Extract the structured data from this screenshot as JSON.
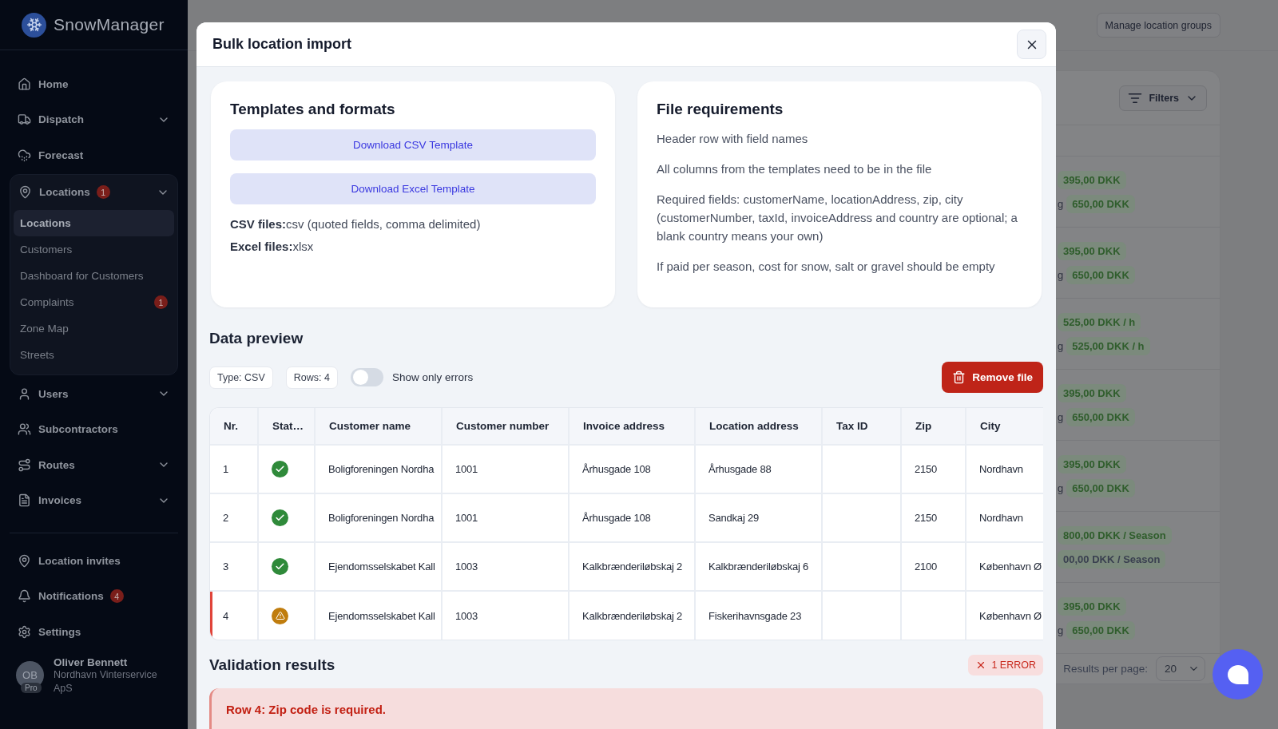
{
  "sidebar": {
    "logo": "SnowManager",
    "nav": [
      {
        "label": "Home"
      },
      {
        "label": "Dispatch",
        "expandable": true
      },
      {
        "label": "Forecast"
      },
      {
        "label": "Locations",
        "badge": "1",
        "expandable": true,
        "children": [
          {
            "label": "Locations",
            "selected": true
          },
          {
            "label": "Customers",
            "selected": false
          },
          {
            "label": "Dashboard for Customers",
            "selected": false
          },
          {
            "label": "Complaints",
            "selected": false,
            "badge": "1"
          },
          {
            "label": "Zone Map",
            "selected": false
          },
          {
            "label": "Streets",
            "selected": false
          }
        ]
      },
      {
        "label": "Users",
        "expandable": true
      },
      {
        "label": "Subcontractors"
      },
      {
        "label": "Routes",
        "expandable": true
      },
      {
        "label": "Invoices",
        "expandable": true
      }
    ],
    "footer_nav": [
      {
        "label": "Location invites"
      },
      {
        "label": "Notifications",
        "badge": "4"
      },
      {
        "label": "Settings"
      }
    ],
    "user": {
      "initials": "OB",
      "plan": "Pro",
      "name": "Oliver Bennett",
      "company": "Nordhavn Vinterservice ApS"
    }
  },
  "page": {
    "header_button": "Manage location groups",
    "filters_button": "Filters",
    "rows": [
      {
        "lines": [
          {
            "price": "395,00 DKK",
            "color": "#2f5d2c"
          },
          {
            "label": "g",
            "price": "650,00 DKK",
            "color": "#2f5d2c"
          }
        ]
      },
      {
        "lines": [
          {
            "price": "395,00 DKK",
            "color": "#2f5d2c"
          },
          {
            "label": "g",
            "price": "650,00 DKK",
            "color": "#2f5d2c"
          }
        ]
      },
      {
        "lines": [
          {
            "price": "525,00 DKK / h",
            "color": "#2f5d2c"
          },
          {
            "label": "g",
            "price": "525,00 DKK / h",
            "color": "#2f5d2c"
          }
        ]
      },
      {
        "lines": [
          {
            "price": "395,00 DKK",
            "color": "#2f5d2c"
          },
          {
            "label": "g",
            "price": "650,00 DKK",
            "color": "#2f5d2c"
          }
        ]
      },
      {
        "lines": [
          {
            "price": "395,00 DKK",
            "color": "#2f5d2c"
          },
          {
            "label": "g",
            "price": "650,00 DKK",
            "color": "#2f5d2c"
          }
        ]
      },
      {
        "lines": [
          {
            "price": "800,00 DKK / Season",
            "color": "#2f5d2c"
          },
          {
            "price": "00,00 DKK / Season",
            "color": "#3a4050"
          }
        ]
      },
      {
        "lines": [
          {
            "price": "395,00 DKK",
            "color": "#2f5d2c"
          },
          {
            "label": "g",
            "price": "650,00 DKK",
            "color": "#2f5d2c"
          }
        ]
      }
    ],
    "per_page_label": "Results per page:",
    "per_page_value": "20"
  },
  "modal": {
    "title": "Bulk location import",
    "templates": {
      "title": "Templates and formats",
      "buttons": [
        "Download CSV Template",
        "Download Excel Template"
      ],
      "formats": [
        "**CSV files:**csv (quoted fields, comma delimited)",
        "**Excel files:**xlsx"
      ]
    },
    "requirements": {
      "title": "File requirements",
      "items": [
        "Header row with field names",
        "All columns from the templates need to be in the file",
        "Required fields: customerName, locationAddress, zip, city (customerNumber, taxId, invoiceAddress and country are optional; a blank country means your own)",
        "If paid per season, cost for snow, salt or gravel should be empty"
      ]
    },
    "preview": {
      "title": "Data preview",
      "chips": [
        "Type: CSV",
        "Rows: 4"
      ],
      "toggle": {
        "label": "Show only errors",
        "on": false
      },
      "remove_button": "Remove file",
      "table": {
        "columns": [
          "Nr.",
          "Stat…",
          "Customer name",
          "Customer number",
          "Invoice address",
          "Location address",
          "Tax ID",
          "Zip",
          "City"
        ],
        "rows": [
          {
            "error": false,
            "kind": "ok",
            "cells": [
              "1",
              "",
              "Boligforeningen Nordha",
              "1001",
              "Århusgade 108",
              "Århusgade 88",
              "",
              "2150",
              "Nordhavn"
            ]
          },
          {
            "error": false,
            "kind": "ok",
            "cells": [
              "2",
              "",
              "Boligforeningen Nordha",
              "1001",
              "Århusgade 108",
              "Sandkaj 29",
              "",
              "2150",
              "Nordhavn"
            ]
          },
          {
            "error": false,
            "kind": "ok",
            "cells": [
              "3",
              "",
              "Ejendomsselskabet Kall",
              "1003",
              "Kalkbrænderiløbskaj 2",
              "Kalkbrænderiløbskaj 6",
              "",
              "2100",
              "København Ø"
            ]
          },
          {
            "error": true,
            "kind": "warning",
            "cells": [
              "4",
              "",
              "Ejendomsselskabet Kall",
              "1003",
              "Kalkbrænderiløbskaj 2",
              "Fiskerihavnsgade 23",
              "",
              "",
              "København Ø"
            ]
          }
        ]
      }
    },
    "validation": {
      "title": "Validation results",
      "badge": "1 ERROR",
      "errors": [
        "Row 4: Zip code is required."
      ]
    }
  }
}
